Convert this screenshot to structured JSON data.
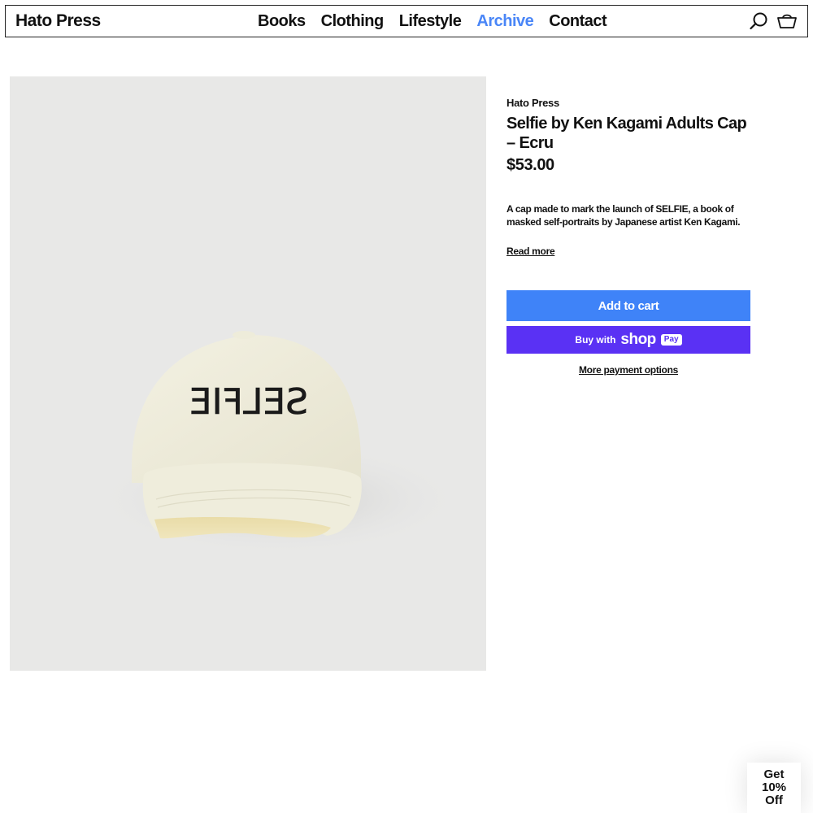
{
  "header": {
    "logo": "Hato Press",
    "nav": [
      {
        "label": "Books",
        "active": false
      },
      {
        "label": "Clothing",
        "active": false
      },
      {
        "label": "Lifestyle",
        "active": false
      },
      {
        "label": "Archive",
        "active": true
      },
      {
        "label": "Contact",
        "active": false
      }
    ],
    "icons": [
      "search-icon",
      "cart-icon"
    ]
  },
  "product": {
    "image_icon": "cap-photo",
    "cap_text": "SELFIE",
    "vendor": "Hato Press",
    "title": "Selfie by Ken Kagami Adults Cap – Ecru",
    "price": "$53.00",
    "description": "A cap made to mark the launch of SELFIE, a book of masked self-portraits by Japanese artist Ken Kagami.",
    "read_more": "Read more",
    "add_to_cart": "Add to cart",
    "buy_with": "Buy with",
    "shop_word": "shop",
    "pay_word": "Pay",
    "more_payment": "More payment options"
  },
  "popup": {
    "discount_text": "Get 10% Off"
  },
  "colors": {
    "accent": "#4a86f7",
    "add_to_cart_bg": "#3f83f8",
    "shop_pay_bg": "#5a31f4",
    "image_bg": "#e8e8e7"
  }
}
